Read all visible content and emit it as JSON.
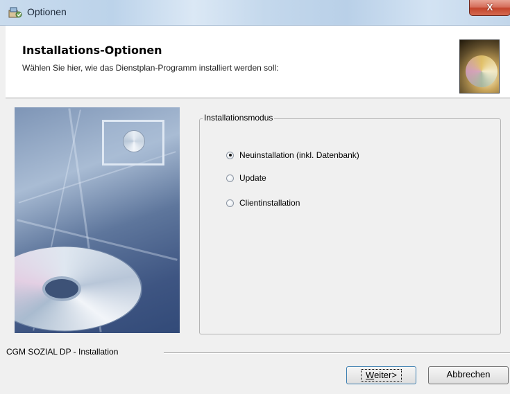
{
  "window": {
    "title": "Optionen",
    "close_glyph": "X",
    "app_icon": "installer-icon"
  },
  "header": {
    "title": "Installations-Optionen",
    "subtitle": "Wählen Sie hier, wie das Dienstplan-Programm installiert werden soll:"
  },
  "groupbox": {
    "legend": "Installationsmodus",
    "options": [
      {
        "label": "Neuinstallation (inkl. Datenbank)",
        "checked": true
      },
      {
        "label": "Update",
        "checked": false
      },
      {
        "label": "Clientinstallation",
        "checked": false
      }
    ]
  },
  "footer": {
    "label": "CGM SOZIAL DP - Installation",
    "next_label": "Weiter>",
    "next_mnemonic": "W",
    "cancel_label": "Abbrechen"
  }
}
